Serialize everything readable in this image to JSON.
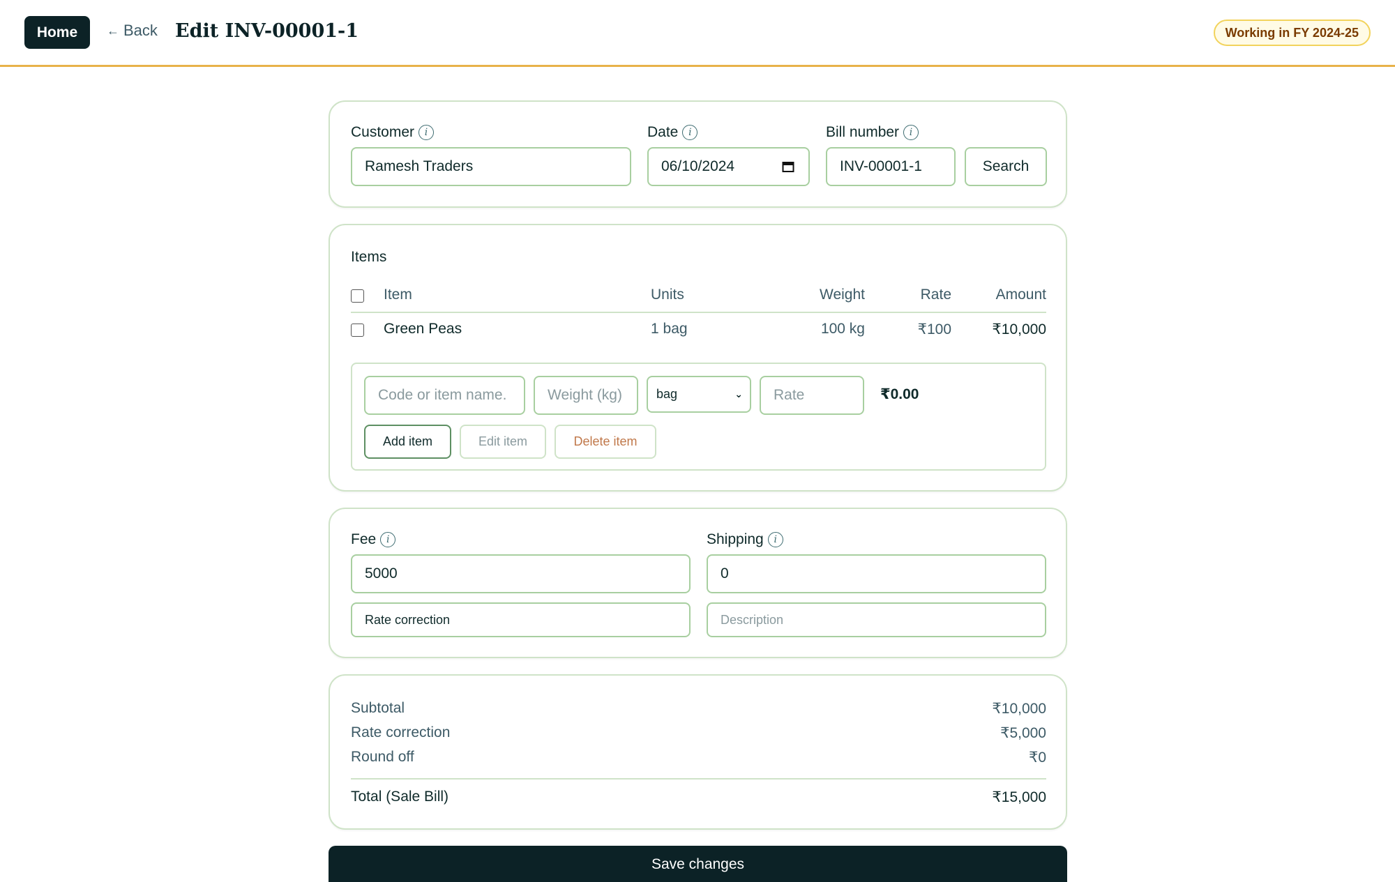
{
  "header": {
    "home_label": "Home",
    "back_label": "Back",
    "title": "Edit INV-00001-1",
    "fy_badge": "Working in FY 2024-25"
  },
  "bill": {
    "customer_label": "Customer",
    "customer_value": "Ramesh Traders",
    "date_label": "Date",
    "date_value": "06/10/2024",
    "bill_number_label": "Bill number",
    "bill_number_value": "INV-00001-1",
    "search_label": "Search"
  },
  "items": {
    "title": "Items",
    "columns": [
      "Item",
      "Units",
      "Weight",
      "Rate",
      "Amount"
    ],
    "rows": [
      {
        "item": "Green Peas",
        "units": "1 bag",
        "weight": "100 kg",
        "rate": "₹100",
        "amount": "₹10,000"
      }
    ],
    "entry": {
      "item_placeholder": "Code or item name.",
      "weight_placeholder": "Weight (kg)",
      "unit_selected": "bag",
      "rate_placeholder": "Rate",
      "amount": "₹0.00",
      "add_label": "Add item",
      "edit_label": "Edit item",
      "delete_label": "Delete item"
    }
  },
  "charges": {
    "fee_label": "Fee",
    "fee_value": "5000",
    "shipping_label": "Shipping",
    "shipping_value": "0",
    "fee_note": "Rate correction",
    "shipping_note_placeholder": "Description"
  },
  "summary": {
    "subtotal_label": "Subtotal",
    "subtotal_value": "₹10,000",
    "rate_correction_label": "Rate correction",
    "rate_correction_value": "₹5,000",
    "round_off_label": "Round off",
    "round_off_value": "₹0",
    "total_label": "Total (Sale Bill)",
    "total_value": "₹15,000"
  },
  "save_label": "Save changes",
  "colors": {
    "primary_dark": "#0c2226",
    "accent_border": "#e8b24a",
    "card_border": "#cfe3c8",
    "field_border": "#a8cfa0",
    "delete_text": "#c0784a"
  }
}
